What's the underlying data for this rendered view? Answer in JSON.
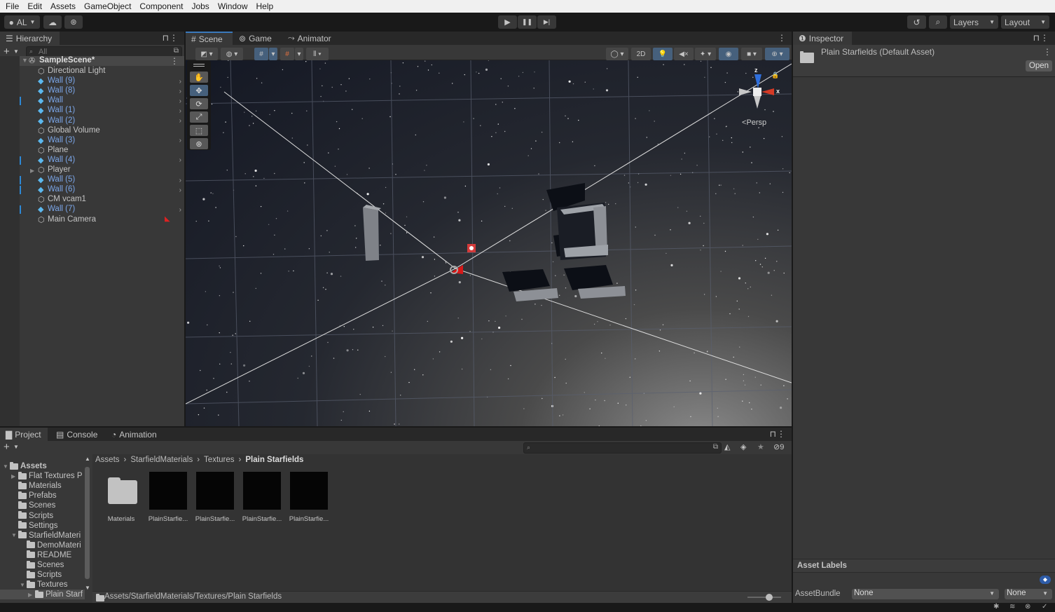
{
  "menu": [
    "File",
    "Edit",
    "Assets",
    "GameObject",
    "Component",
    "Jobs",
    "Window",
    "Help"
  ],
  "toolbar": {
    "account_label": "AL",
    "play_icon": "▶",
    "pause_icon": "❚❚",
    "step_icon": "▶|",
    "layers_label": "Layers",
    "layout_label": "Layout"
  },
  "hierarchy": {
    "tab_label": "Hierarchy",
    "search_placeholder": "All",
    "scene_name": "SampleScene*",
    "items": [
      {
        "label": "Directional Light",
        "prefab": false,
        "children": false,
        "marked": false
      },
      {
        "label": "Wall (9)",
        "prefab": true,
        "children": true,
        "marked": false
      },
      {
        "label": "Wall (8)",
        "prefab": true,
        "children": true,
        "marked": false
      },
      {
        "label": "Wall",
        "prefab": true,
        "children": true,
        "marked": true
      },
      {
        "label": "Wall (1)",
        "prefab": true,
        "children": true,
        "marked": false
      },
      {
        "label": "Wall (2)",
        "prefab": true,
        "children": true,
        "marked": false
      },
      {
        "label": "Global Volume",
        "prefab": false,
        "children": false,
        "marked": false
      },
      {
        "label": "Wall (3)",
        "prefab": true,
        "children": true,
        "marked": false
      },
      {
        "label": "Plane",
        "prefab": false,
        "children": false,
        "marked": false
      },
      {
        "label": "Wall (4)",
        "prefab": true,
        "children": true,
        "marked": true
      },
      {
        "label": "Player",
        "prefab": false,
        "children": false,
        "marked": false,
        "expandable": true
      },
      {
        "label": "Wall (5)",
        "prefab": true,
        "children": true,
        "marked": true
      },
      {
        "label": "Wall (6)",
        "prefab": true,
        "children": true,
        "marked": true
      },
      {
        "label": "CM vcam1",
        "prefab": false,
        "children": false,
        "marked": false
      },
      {
        "label": "Wall (7)",
        "prefab": true,
        "children": true,
        "marked": true
      },
      {
        "label": "Main Camera",
        "prefab": false,
        "children": false,
        "marked": false,
        "badge": true
      }
    ]
  },
  "scene_view": {
    "tabs": [
      {
        "label": "Scene",
        "icon": "#"
      },
      {
        "label": "Game",
        "icon": "⊚"
      },
      {
        "label": "Animator",
        "icon": "⤳"
      }
    ],
    "btn_2d": "2D",
    "gizmo_axis_z": "z",
    "gizmo_axis_x": "x",
    "projection_label": "Persp"
  },
  "inspector": {
    "tab_label": "Inspector",
    "title": "Plain Starfields (Default Asset)",
    "open_label": "Open",
    "asset_labels_heading": "Asset Labels",
    "assetbundle_label": "AssetBundle",
    "assetbundle_value": "None",
    "assetbundle_variant": "None"
  },
  "project": {
    "tabs": [
      {
        "label": "Project",
        "icon": "▇"
      },
      {
        "label": "Console",
        "icon": "▤"
      },
      {
        "label": "Animation",
        "icon": "◔"
      }
    ],
    "hidden_count": "9",
    "breadcrumb": [
      "Assets",
      "StarfieldMaterials",
      "Textures",
      "Plain Starfields"
    ],
    "tree": [
      {
        "label": "Assets",
        "depth": 0,
        "arrow": "▼",
        "bold": true,
        "open": true
      },
      {
        "label": "Flat Textures P",
        "depth": 1,
        "arrow": "▶"
      },
      {
        "label": "Materials",
        "depth": 1,
        "arrow": ""
      },
      {
        "label": "Prefabs",
        "depth": 1,
        "arrow": ""
      },
      {
        "label": "Scenes",
        "depth": 1,
        "arrow": ""
      },
      {
        "label": "Scripts",
        "depth": 1,
        "arrow": ""
      },
      {
        "label": "Settings",
        "depth": 1,
        "arrow": ""
      },
      {
        "label": "StarfieldMateri",
        "depth": 1,
        "arrow": "▼",
        "open": true
      },
      {
        "label": "DemoMateri",
        "depth": 2,
        "arrow": ""
      },
      {
        "label": "README",
        "depth": 2,
        "arrow": ""
      },
      {
        "label": "Scenes",
        "depth": 2,
        "arrow": ""
      },
      {
        "label": "Scripts",
        "depth": 2,
        "arrow": ""
      },
      {
        "label": "Textures",
        "depth": 2,
        "arrow": "▼",
        "open": true
      },
      {
        "label": "Plain Starf",
        "depth": 3,
        "arrow": "▶",
        "selected": true
      }
    ],
    "assets": [
      {
        "label": "Materials",
        "type": "folder"
      },
      {
        "label": "PlainStarfie...",
        "type": "texture"
      },
      {
        "label": "PlainStarfie...",
        "type": "texture"
      },
      {
        "label": "PlainStarfie...",
        "type": "texture"
      },
      {
        "label": "PlainStarfie...",
        "type": "texture"
      }
    ],
    "path": "Assets/StarfieldMaterials/Textures/Plain Starfields",
    "zoom_slider": 0.5
  }
}
